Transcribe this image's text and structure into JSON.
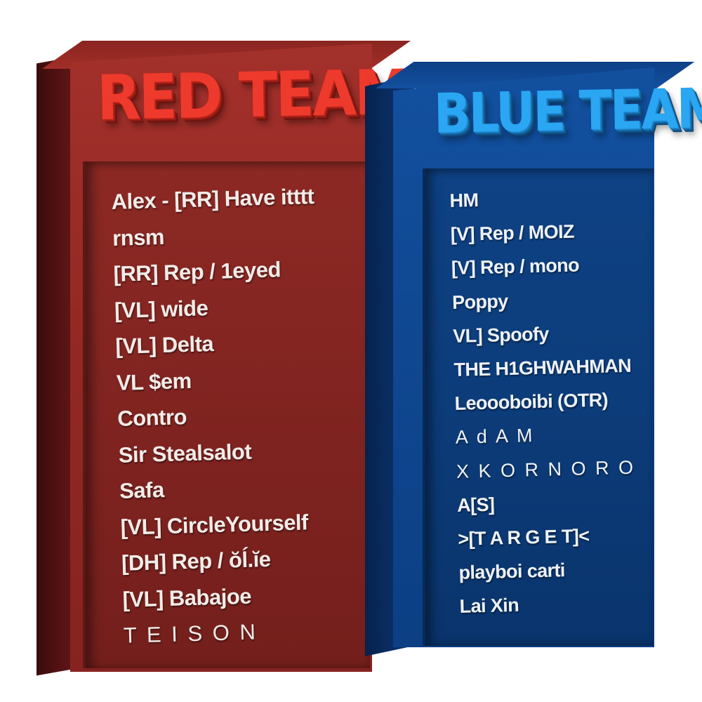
{
  "red_team": {
    "title": "RED TEAM",
    "color": "#ee3a2c",
    "players": [
      "Alex - [RR] Have itttt",
      "rnsm",
      "[RR] Rep / 1eyed",
      "[VL] wide",
      "[VL] Delta",
      "VL $em",
      "Contro",
      "Sir Stealsalot",
      "Safa",
      "[VL] CircleYourself",
      "[DH] Rep / ŏĺ.ĭe",
      "[VL] Babajoe",
      "T E I S O N"
    ]
  },
  "blue_team": {
    "title": "BLUE TEAM",
    "color": "#2aa6f2",
    "players": [
      "HM",
      "[V] Rep / MOIZ",
      "[V] Rep / mono",
      "Poppy",
      "VL] Spoofy",
      "THE H1GHWAHMAN",
      "Leoooboibi (OTR)",
      "A d A M",
      "X K O R N O R O",
      "A[S]",
      ">[T A R G E T]<",
      "playboi carti",
      "Lai Xin"
    ]
  }
}
